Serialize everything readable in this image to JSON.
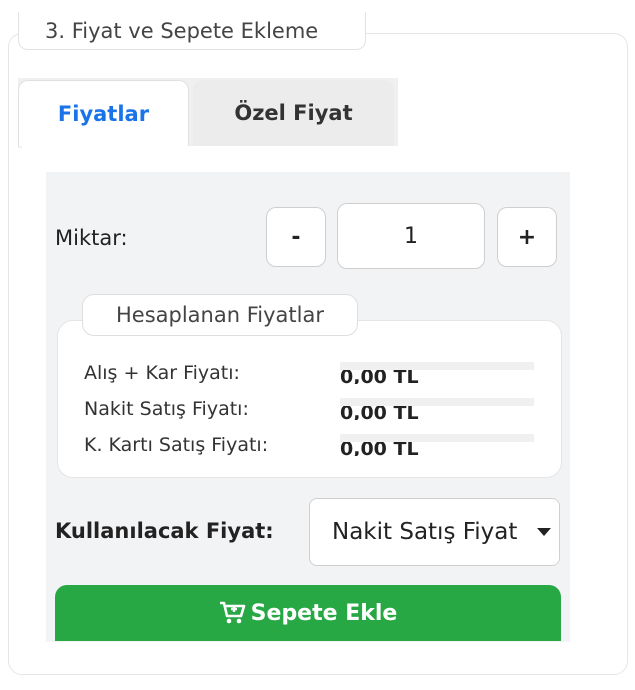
{
  "section": {
    "legend": "3. Fiyat ve Sepete Ekleme"
  },
  "tabs": [
    {
      "label": "Fiyatlar",
      "active": true
    },
    {
      "label": "Özel Fiyat",
      "active": false
    }
  ],
  "quantity": {
    "label": "Miktar:",
    "decrement": "-",
    "value": "1",
    "increment": "+"
  },
  "prices": {
    "legend": "Hesaplanan Fiyatlar",
    "rows": [
      {
        "label": "Alış + Kar Fiyatı:",
        "value": "0,00 TL"
      },
      {
        "label": "Nakit Satış Fiyatı:",
        "value": "0,00 TL"
      },
      {
        "label": "K. Kartı Satış Fiyatı:",
        "value": "0,00 TL"
      }
    ]
  },
  "price_select": {
    "label": "Kullanılacak Fiyat:",
    "value": "Nakit Satış Fiyatı"
  },
  "add_to_cart": {
    "label": "Sepete Ekle",
    "icon": "cart-plus-icon"
  },
  "colors": {
    "accent": "#1a73e8",
    "success": "#28a745"
  }
}
